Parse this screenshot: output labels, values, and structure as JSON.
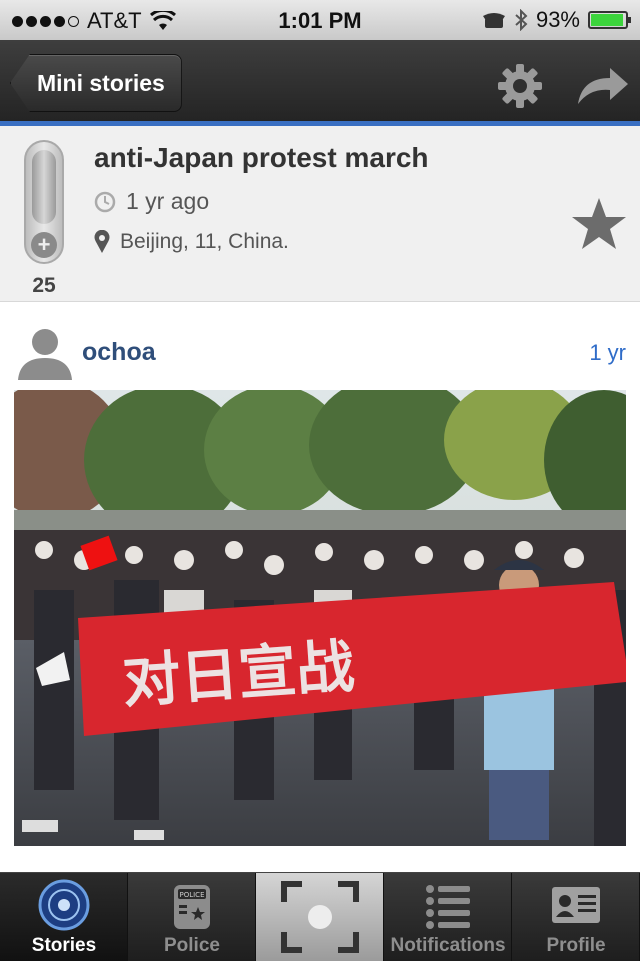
{
  "status_bar": {
    "carrier": "AT&T",
    "time": "1:01 PM",
    "battery": "93%",
    "battery_level": 0.93
  },
  "nav": {
    "back_label": "Mini stories",
    "icons": [
      "gear-icon",
      "share-arrow-icon"
    ]
  },
  "story": {
    "title": "anti-Japan protest march",
    "time_ago": "1 yr ago",
    "location": "Beijing, 11, China.",
    "vote_count": "25"
  },
  "post": {
    "username": "ochoa",
    "time": "1 yr",
    "photo_banner_text": "对日宣战"
  },
  "tabs": [
    {
      "label": "Stories",
      "icon": "radar-icon"
    },
    {
      "label": "Police",
      "icon": "police-radio-icon"
    },
    {
      "label": "",
      "icon": "camera-capture-icon"
    },
    {
      "label": "Notifications",
      "icon": "list-icon"
    },
    {
      "label": "Profile",
      "icon": "profile-card-icon"
    }
  ],
  "colors": {
    "accent": "#3a6fc2",
    "username": "#2f4e7a",
    "link": "#2f6cc8",
    "banner_red": "#d8262e"
  }
}
